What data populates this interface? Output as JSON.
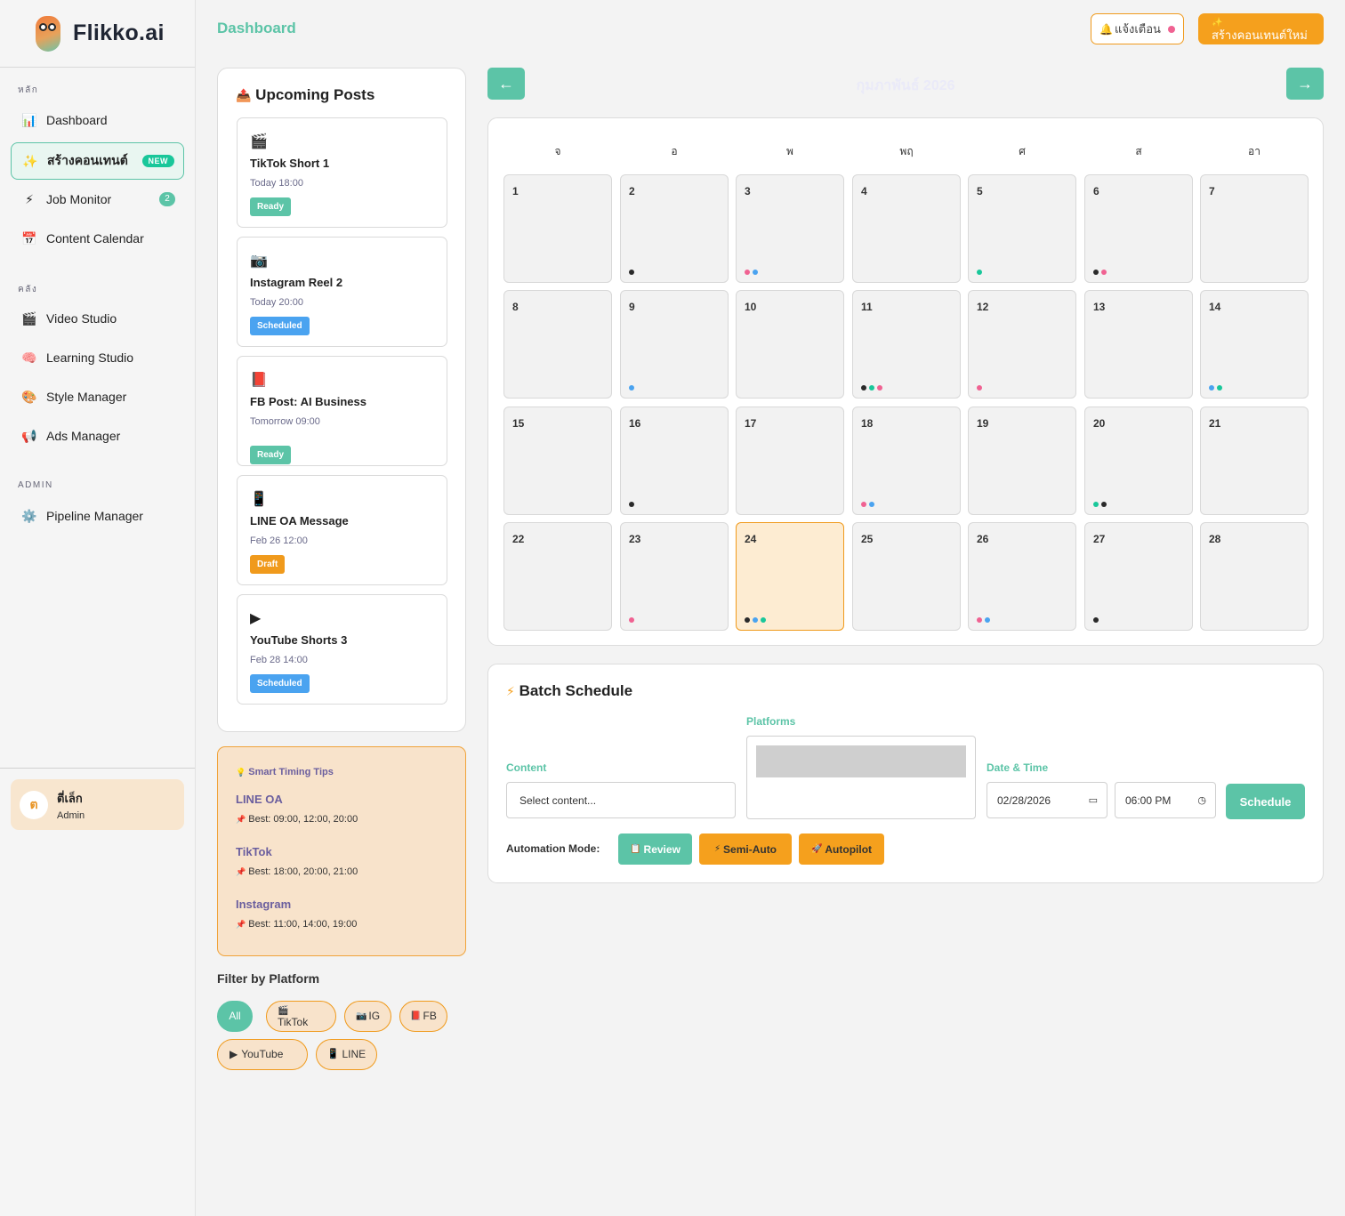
{
  "app": {
    "name": "Flikko.ai"
  },
  "sidebar": {
    "sections": {
      "main": "หลัก",
      "warehouse": "คลัง",
      "admin": "ADMIN"
    },
    "items": [
      {
        "label": "Dashboard",
        "icon": "📊"
      },
      {
        "label": "สร้างคอนเทนต์",
        "icon": "✨",
        "badge": "NEW"
      },
      {
        "label": "Job Monitor",
        "icon": "⚡",
        "badge": "2"
      },
      {
        "label": "Content Calendar",
        "icon": "📅"
      },
      {
        "label": "Video Studio",
        "icon": "🎬"
      },
      {
        "label": "Learning Studio",
        "icon": "🧠"
      },
      {
        "label": "Style Manager",
        "icon": "🎨"
      },
      {
        "label": "Ads Manager",
        "icon": "📢"
      },
      {
        "label": "Pipeline Manager",
        "icon": "⚙️"
      }
    ],
    "user": {
      "initial": "ต",
      "name": "ตี่เล็ก",
      "role": "Admin"
    }
  },
  "header": {
    "title": "Dashboard",
    "notify_icon": "🔔",
    "notify_label": "แจ้งเตือน",
    "create_icon": "✨",
    "create_label": "สร้างคอนเทนต์ใหม่"
  },
  "upcoming": {
    "icon": "📤",
    "title": "Upcoming Posts",
    "posts": [
      {
        "icon": "🎬",
        "title": "TikTok Short 1",
        "time": "Today 18:00",
        "status": "Ready"
      },
      {
        "icon": "📷",
        "title": "Instagram Reel 2",
        "time": "Today 20:00",
        "status": "Scheduled"
      },
      {
        "icon": "📕",
        "title": "FB Post: AI Business",
        "time": "Tomorrow 09:00",
        "status": "Ready"
      },
      {
        "icon": "📱",
        "title": "LINE OA Message",
        "time": "Feb 26 12:00",
        "status": "Draft"
      },
      {
        "icon": "▶",
        "title": "YouTube Shorts 3",
        "time": "Feb 28 14:00",
        "status": "Scheduled"
      }
    ],
    "status_colors": {
      "Ready": "#5cc4a7",
      "Scheduled": "#4aa3f0",
      "Draft": "#f09a1c"
    }
  },
  "tips": {
    "icon": "💡",
    "title": "Smart Timing Tips",
    "pin_icon": "📌",
    "items": [
      {
        "platform": "LINE OA",
        "best": "Best: 09:00, 12:00, 20:00"
      },
      {
        "platform": "TikTok",
        "best": "Best: 18:00, 20:00, 21:00"
      },
      {
        "platform": "Instagram",
        "best": "Best: 11:00, 14:00, 19:00"
      }
    ]
  },
  "filter": {
    "title": "Filter by Platform",
    "chips": [
      {
        "icon": "",
        "label": "All",
        "active": true
      },
      {
        "icon": "🎬",
        "label": "TikTok"
      },
      {
        "icon": "📷",
        "label": "IG"
      },
      {
        "icon": "📕",
        "label": "FB"
      },
      {
        "icon": "▶",
        "label": "YouTube"
      },
      {
        "icon": "📱",
        "label": "LINE"
      }
    ]
  },
  "calendar": {
    "month_label": "กุมภาพันธ์ 2026",
    "prev": "←",
    "next": "→",
    "weekdays": [
      "จ",
      "อ",
      "พ",
      "พฤ",
      "ศ",
      "ส",
      "อา"
    ],
    "today": 24,
    "dot_colors": {
      "black": "#2a2a2a",
      "pink": "#f06292",
      "blue": "#4aa3f0",
      "green": "#19c79a"
    },
    "days": [
      {
        "n": "1",
        "dots": []
      },
      {
        "n": "2",
        "dots": [
          "black"
        ]
      },
      {
        "n": "3",
        "dots": [
          "pink",
          "blue"
        ]
      },
      {
        "n": "4",
        "dots": []
      },
      {
        "n": "5",
        "dots": [
          "green"
        ]
      },
      {
        "n": "6",
        "dots": [
          "black",
          "pink"
        ]
      },
      {
        "n": "7",
        "dots": []
      },
      {
        "n": "8",
        "dots": []
      },
      {
        "n": "9",
        "dots": [
          "blue"
        ]
      },
      {
        "n": "10",
        "dots": []
      },
      {
        "n": "11",
        "dots": [
          "black",
          "green",
          "pink"
        ]
      },
      {
        "n": "12",
        "dots": [
          "pink"
        ]
      },
      {
        "n": "13",
        "dots": []
      },
      {
        "n": "14",
        "dots": [
          "blue",
          "green"
        ]
      },
      {
        "n": "15",
        "dots": []
      },
      {
        "n": "16",
        "dots": [
          "black"
        ]
      },
      {
        "n": "17",
        "dots": []
      },
      {
        "n": "18",
        "dots": [
          "pink",
          "blue"
        ]
      },
      {
        "n": "19",
        "dots": []
      },
      {
        "n": "20",
        "dots": [
          "green",
          "black"
        ]
      },
      {
        "n": "21",
        "dots": []
      },
      {
        "n": "22",
        "dots": []
      },
      {
        "n": "23",
        "dots": [
          "pink"
        ]
      },
      {
        "n": "24",
        "dots": [
          "black",
          "blue",
          "green"
        ]
      },
      {
        "n": "25",
        "dots": []
      },
      {
        "n": "26",
        "dots": [
          "pink",
          "blue"
        ]
      },
      {
        "n": "27",
        "dots": [
          "black"
        ]
      },
      {
        "n": "28",
        "dots": []
      }
    ]
  },
  "batch": {
    "icon": "⚡",
    "title": "Batch Schedule",
    "content_label": "Content",
    "content_value": "Select content...",
    "platforms_label": "Platforms",
    "datetime_label": "Date & Time",
    "date_value": "02/28/2026",
    "time_value": "06:00 PM",
    "schedule_label": "Schedule",
    "automation_label": "Automation Mode:",
    "modes": [
      {
        "icon": "📋",
        "label": "Review"
      },
      {
        "icon": "⚡",
        "label": "Semi-Auto"
      },
      {
        "icon": "🚀",
        "label": "Autopilot"
      }
    ]
  },
  "colors": {
    "accent": "#5cc4a7",
    "orange": "#f5a01d",
    "peach": "#f8e3cb"
  }
}
